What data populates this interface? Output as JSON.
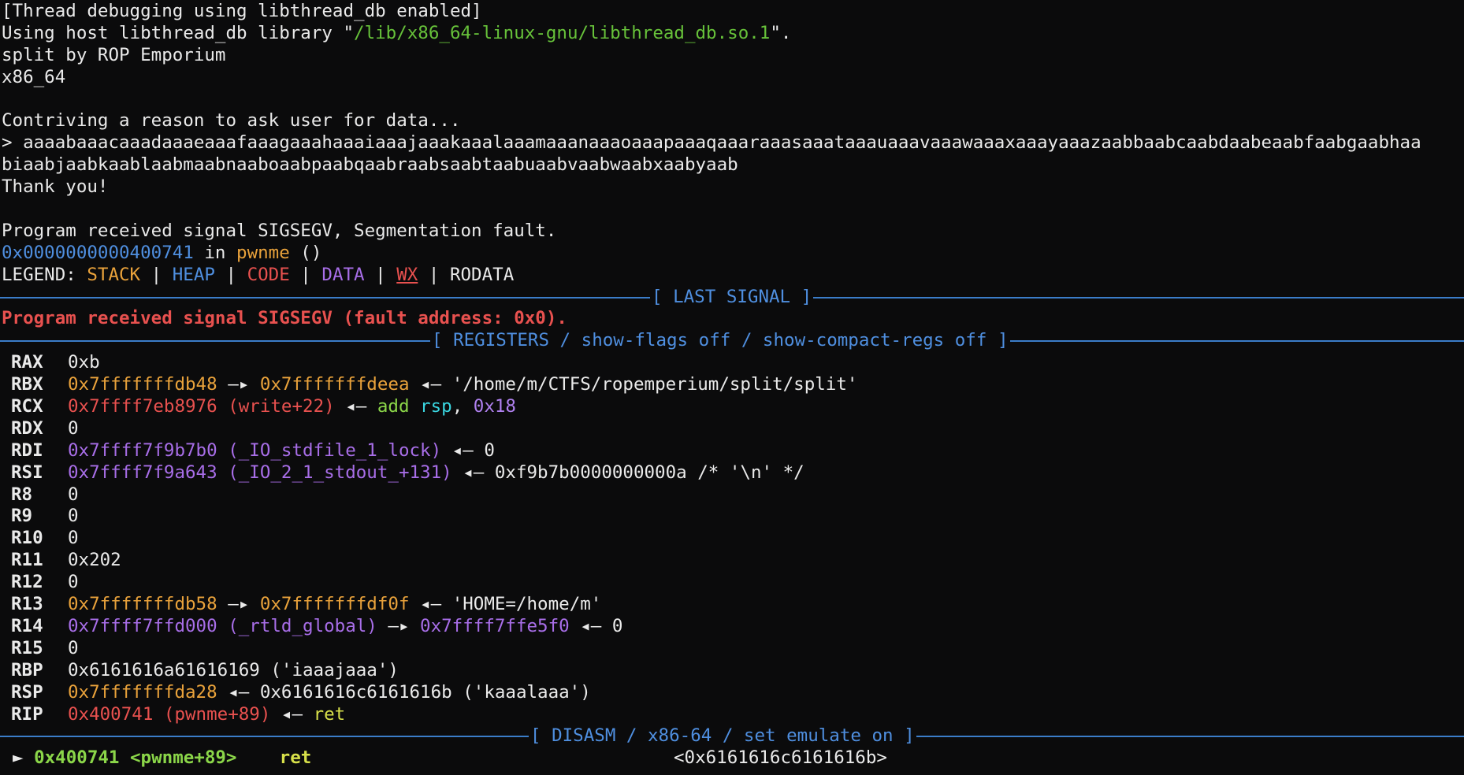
{
  "colors": {
    "background": "#0b0b0c",
    "text": "#eaeaea",
    "stack": "#e9a23b",
    "heap": "#4f8fe0",
    "code": "#e8514f",
    "data": "#a86ee8",
    "wx": "#e8514f",
    "separator": "#3b7dc9",
    "string": "#67c23a"
  },
  "header": {
    "l1": "[Thread debugging using libthread_db enabled]",
    "l2_pre": "Using host libthread_db library \"",
    "l2_path": "/lib/x86_64-linux-gnu/libthread_db.so.1",
    "l2_post": "\".",
    "l3": "split by ROP Emporium",
    "l4": "x86_64",
    "l6": "Contriving a reason to ask user for data...",
    "l7": "> aaaabaaacaaadaaaeaaafaaagaaahaaaiaaajaaakaaalaaamaaanaaaoaaapaaaqaaaraaasaaataaauaaavaaawaaaxaaayaaazaabbaabcaabdaabeaabfaabgaabhaa",
    "l8": "biaabjaabkaablaabmaabnaaboaabpaabqaabraabsaabtaabuaabvaabwaabxaabyaab",
    "l9": "Thank you!",
    "l11": "Program received signal SIGSEGV, Segmentation fault.",
    "l12_addr": "0x0000000000400741",
    "l12_in": " in ",
    "l12_func": "pwnme",
    "l12_post": " ()"
  },
  "legend": {
    "prefix": "LEGEND: ",
    "stack": "STACK",
    "heap": "HEAP",
    "code": "CODE",
    "data": "DATA",
    "wx": "WX",
    "rodata": "RODATA",
    "sep": " | "
  },
  "sections": {
    "last_signal": "[ LAST SIGNAL ]",
    "signal_msg": "Program received signal SIGSEGV (fault address: 0x0).",
    "registers": "[ REGISTERS / show-flags off / show-compact-regs off ]",
    "disasm": "[ DISASM / x86-64 / set emulate on ]"
  },
  "registers": {
    "rax": {
      "name": "RAX",
      "v": "0xb"
    },
    "rbx": {
      "name": "RBX",
      "v1": "0x7fffffffdb48",
      "a1": " —▸ ",
      "v2": "0x7fffffffdeea",
      "a2": " ◂— ",
      "v3": "'/home/m/CTFS/ropemperium/split/split'"
    },
    "rcx": {
      "name": "RCX",
      "v1": "0x7ffff7eb8976",
      "sym": " (write+22)",
      "a1": " ◂— ",
      "op": "add",
      "r": " rsp",
      "comma": ", ",
      "imm": "0x18"
    },
    "rdx": {
      "name": "RDX",
      "v": "0"
    },
    "rdi": {
      "name": "RDI",
      "v1": "0x7ffff7f9b7b0",
      "sym": " (_IO_stdfile_1_lock)",
      "a1": " ◂— ",
      "v2": "0"
    },
    "rsi": {
      "name": "RSI",
      "v1": "0x7ffff7f9a643",
      "sym": " (_IO_2_1_stdout_+131)",
      "a1": " ◂— ",
      "v2": "0xf9b7b0000000000a /* '\\n' */"
    },
    "r8": {
      "name": "R8",
      "v": "0"
    },
    "r9": {
      "name": "R9",
      "v": "0"
    },
    "r10": {
      "name": "R10",
      "v": "0"
    },
    "r11": {
      "name": "R11",
      "v": "0x202"
    },
    "r12": {
      "name": "R12",
      "v": "0"
    },
    "r13": {
      "name": "R13",
      "v1": "0x7fffffffdb58",
      "a1": " —▸ ",
      "v2": "0x7fffffffdf0f",
      "a2": " ◂— ",
      "v3": "'HOME=/home/m'"
    },
    "r14": {
      "name": "R14",
      "v1": "0x7ffff7ffd000",
      "sym": " (_rtld_global)",
      "a1": " —▸ ",
      "v2": "0x7ffff7ffe5f0",
      "a2": " ◂— ",
      "v3": "0"
    },
    "r15": {
      "name": "R15",
      "v": "0"
    },
    "rbp": {
      "name": "RBP",
      "v": "0x6161616a61616169 ('iaaajaaa')"
    },
    "rsp": {
      "name": "RSP",
      "v1": "0x7fffffffda28",
      "a1": " ◂— ",
      "v2": "0x6161616c6161616b ('kaaalaaa')"
    },
    "rip": {
      "name": "RIP",
      "v1": "0x400741",
      "sym": " (pwnme+89)",
      "a1": " ◂— ",
      "op": "ret"
    }
  },
  "disasm": {
    "arrow": "►",
    "addr": " 0x400741 <pwnme+89>",
    "gap": "    ",
    "op": "ret",
    "target": "<0x6161616c6161616b>"
  }
}
